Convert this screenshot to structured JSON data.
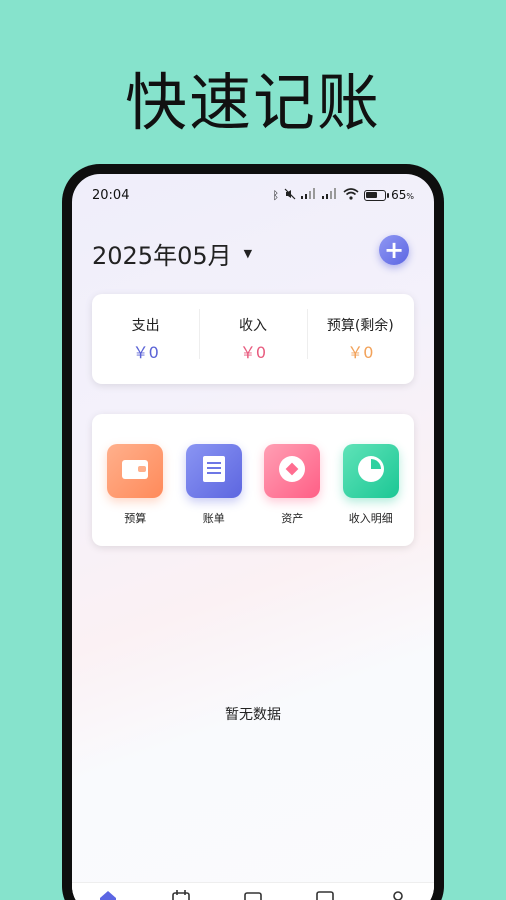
{
  "promo": {
    "title": "快速记账"
  },
  "status": {
    "time": "20:04",
    "battery": "65",
    "battery_unit": "%",
    "battery_level": 0.65
  },
  "header": {
    "month": "2025年05月"
  },
  "summary": [
    {
      "label": "支出",
      "value": "￥0",
      "color": "#5b63d6"
    },
    {
      "label": "收入",
      "value": "￥0",
      "color": "#e85c7f"
    },
    {
      "label": "预算(剩余)",
      "value": "￥0",
      "color": "#f2a25a"
    }
  ],
  "features": [
    {
      "label": "预算",
      "icon": "wallet-icon",
      "colors": [
        "#ffb08c",
        "#ff8a5a"
      ]
    },
    {
      "label": "账单",
      "icon": "document-icon",
      "colors": [
        "#8a95f3",
        "#5d66e0"
      ]
    },
    {
      "label": "资产",
      "icon": "diamond-icon",
      "colors": [
        "#ff9fb4",
        "#ff5f86"
      ]
    },
    {
      "label": "收入明细",
      "icon": "pie-chart-icon",
      "colors": [
        "#5fe3b8",
        "#1cc795"
      ]
    }
  ],
  "empty": {
    "text": "暂无数据"
  },
  "tabs": [
    {
      "icon": "home-icon"
    },
    {
      "icon": "calendar-icon"
    },
    {
      "icon": "wallet-tab-icon"
    },
    {
      "icon": "chart-tab-icon"
    },
    {
      "icon": "profile-icon"
    }
  ]
}
